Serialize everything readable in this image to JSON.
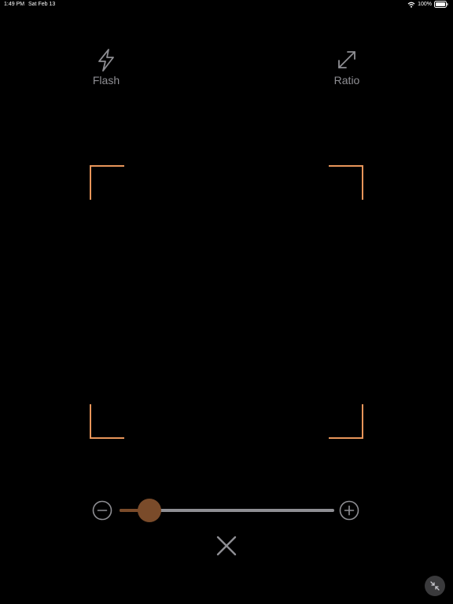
{
  "status_bar": {
    "time": "1:49 PM",
    "date": "Sat Feb 13",
    "battery_text": "100%"
  },
  "controls": {
    "flash": {
      "label": "Flash",
      "icon": "lightning-bolt-icon"
    },
    "ratio": {
      "label": "Ratio",
      "icon": "diagonal-arrows-icon"
    }
  },
  "frame": {
    "corner_color": "#e8955a"
  },
  "zoom": {
    "level_fraction": 0.14,
    "track_color": "#8e8e93",
    "thumb_color": "#7a4b2a",
    "minus_icon": "minus-circle-icon",
    "plus_icon": "plus-circle-icon"
  },
  "actions": {
    "close_icon": "close-icon",
    "minimize_icon": "minimize-arrows-icon"
  },
  "colors": {
    "background": "#000000",
    "label": "#8e8e93",
    "accent": "#e8955a"
  }
}
